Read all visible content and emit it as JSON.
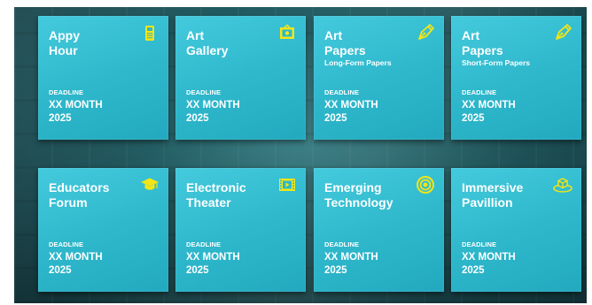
{
  "tiles": [
    {
      "title": "Appy Hour",
      "subtitle": "",
      "icon": "phone-icon",
      "deadline_label": "DEADLINE",
      "month": "XX MONTH",
      "year": "2025"
    },
    {
      "title": "Art Gallery",
      "subtitle": "",
      "icon": "picture-frame-icon",
      "deadline_label": "DEADLINE",
      "month": "XX MONTH",
      "year": "2025"
    },
    {
      "title": "Art Papers",
      "subtitle": "Long-Form Papers",
      "icon": "pen-icon",
      "deadline_label": "DEADLINE",
      "month": "XX MONTH",
      "year": "2025"
    },
    {
      "title": "Art Papers",
      "subtitle": "Short-Form Papers",
      "icon": "pen-icon",
      "deadline_label": "DEADLINE",
      "month": "XX MONTH",
      "year": "2025"
    },
    {
      "title": "Educators Forum",
      "subtitle": "",
      "icon": "graduation-cap-icon",
      "deadline_label": "DEADLINE",
      "month": "XX MONTH",
      "year": "2025"
    },
    {
      "title": "Electronic Theater",
      "subtitle": "",
      "icon": "film-strip-icon",
      "deadline_label": "DEADLINE",
      "month": "XX MONTH",
      "year": "2025"
    },
    {
      "title": "Emerging Technology",
      "subtitle": "",
      "icon": "target-icon",
      "deadline_label": "DEADLINE",
      "month": "XX MONTH",
      "year": "2025"
    },
    {
      "title": "Immersive Pavillion",
      "subtitle": "",
      "icon": "cube-icon",
      "deadline_label": "DEADLINE",
      "month": "XX MONTH",
      "year": "2025"
    }
  ],
  "colors": {
    "tile": "#2fb8cc",
    "icon": "#f3e616",
    "text": "#ffffff"
  }
}
